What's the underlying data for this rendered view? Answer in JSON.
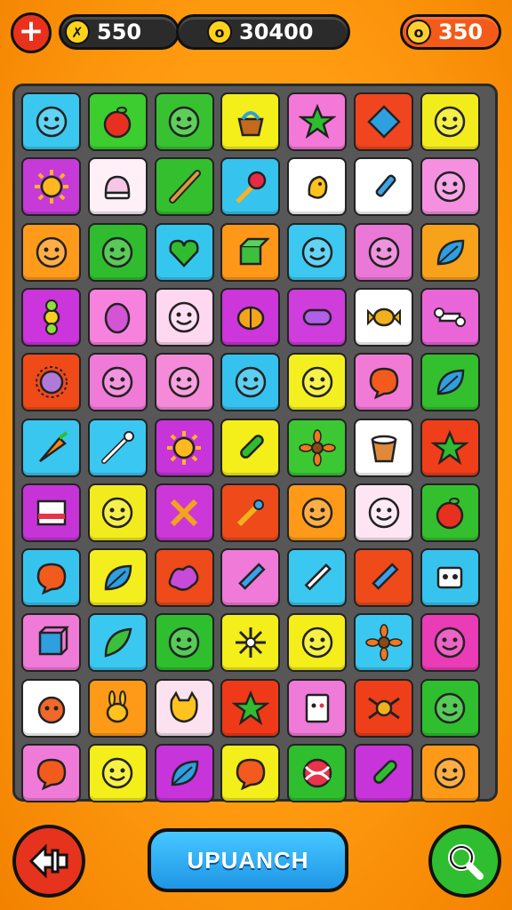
{
  "hud": {
    "plus_label": "+",
    "currency_a": "550",
    "currency_b": "30400",
    "currency_c": "350",
    "coin_symbol_a": "✗",
    "coin_symbol_b": "o",
    "coin_symbol_c": "o"
  },
  "board": {
    "rows": [
      [
        [
          "#3ac8f0",
          "face"
        ],
        [
          "#3ccd2e",
          "fruit"
        ],
        [
          "#38c232",
          "face"
        ],
        [
          "#f4ee1a",
          "basket"
        ],
        [
          "#f478d8",
          "star"
        ],
        [
          "#f0451e",
          "diamond"
        ],
        [
          "#f2ec1c",
          "face"
        ]
      ],
      [
        [
          "#c63ad8",
          "sun"
        ],
        [
          "#fff0f8",
          "cap"
        ],
        [
          "#34c02e",
          "stick"
        ],
        [
          "#36c4ee",
          "pin"
        ],
        [
          "#ffffff",
          "bird"
        ],
        [
          "#ffffff",
          "brush"
        ],
        [
          "#f590e0",
          "face"
        ]
      ],
      [
        [
          "#ff9a1a",
          "face"
        ],
        [
          "#2fbd2f",
          "face"
        ],
        [
          "#35c6ee",
          "heart"
        ],
        [
          "#ff9818",
          "box"
        ],
        [
          "#3cc8f0",
          "face"
        ],
        [
          "#ea78d6",
          "face"
        ],
        [
          "#f7a21a",
          "leaf"
        ]
      ],
      [
        [
          "#cc34dc",
          "flower"
        ],
        [
          "#f782de",
          "egg"
        ],
        [
          "#ffd8f0",
          "face"
        ],
        [
          "#cc36da",
          "lantern"
        ],
        [
          "#cf3ddc",
          "capsule"
        ],
        [
          "#ffffff",
          "candy"
        ],
        [
          "#ea66d8",
          "bone"
        ]
      ],
      [
        [
          "#f04a18",
          "urchin"
        ],
        [
          "#f07ad8",
          "face"
        ],
        [
          "#f58ad8",
          "face"
        ],
        [
          "#36c2ee",
          "face"
        ],
        [
          "#f4ef20",
          "face"
        ],
        [
          "#f07ad6",
          "bubble"
        ],
        [
          "#34c02e",
          "leaf"
        ]
      ],
      [
        [
          "#39c6ef",
          "carrot"
        ],
        [
          "#3ac8f2",
          "wand"
        ],
        [
          "#c634da",
          "sun"
        ],
        [
          "#f4ee1a",
          "rocket"
        ],
        [
          "#3bc833",
          "sunflower"
        ],
        [
          "#ffffff",
          "bucket"
        ],
        [
          "#ef3e1a",
          "star"
        ]
      ],
      [
        [
          "#c634d8",
          "book"
        ],
        [
          "#f2ec1e",
          "face"
        ],
        [
          "#cc38d8",
          "cross"
        ],
        [
          "#ee4a1a",
          "tools"
        ],
        [
          "#ff9a18",
          "face"
        ],
        [
          "#fde6f2",
          "face"
        ],
        [
          "#34c02e",
          "fruit"
        ]
      ],
      [
        [
          "#36c4ee",
          "bubble"
        ],
        [
          "#f4ee1e",
          "leaf"
        ],
        [
          "#ee4a1a",
          "splat"
        ],
        [
          "#f07ad8",
          "pencil"
        ],
        [
          "#3ac8f0",
          "pen"
        ],
        [
          "#ee4a1a",
          "pencil"
        ],
        [
          "#36c4ee",
          "robot"
        ]
      ],
      [
        [
          "#f07ad8",
          "cube"
        ],
        [
          "#3ac8f0",
          "feather"
        ],
        [
          "#2ebe2e",
          "face"
        ],
        [
          "#f4ee1a",
          "snowflake"
        ],
        [
          "#f4ee1a",
          "face"
        ],
        [
          "#3ac8f0",
          "sunflower"
        ],
        [
          "#e93cb6",
          "face"
        ]
      ],
      [
        [
          "#ffffff",
          "critter"
        ],
        [
          "#ff9a18",
          "bunny"
        ],
        [
          "#fbe2ee",
          "cat"
        ],
        [
          "#ef3a1a",
          "star"
        ],
        [
          "#f07ad8",
          "card"
        ],
        [
          "#ef3e1a",
          "spider"
        ],
        [
          "#2ebe2e",
          "face"
        ]
      ],
      [
        [
          "#f07ad8",
          "bubble"
        ],
        [
          "#f4ee1a",
          "face"
        ],
        [
          "#c634da",
          "leaf"
        ],
        [
          "#f4ee1a",
          "bubble"
        ],
        [
          "#2ebe2e",
          "ball"
        ],
        [
          "#c634da",
          "rocket"
        ],
        [
          "#ff9a18",
          "face"
        ]
      ]
    ]
  },
  "controls": {
    "launch_label": "UPUANCH"
  }
}
